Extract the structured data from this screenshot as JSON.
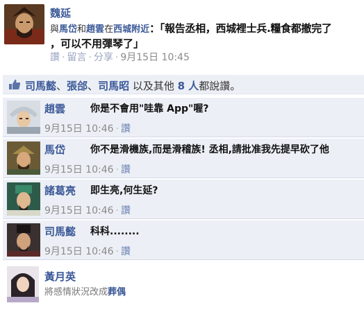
{
  "post": {
    "author": "魏延",
    "with_prefix": "與",
    "tag1": "馬岱",
    "and_word": "和",
    "tag2": "趙雲",
    "at_word": "在",
    "place": "西城附近",
    "message_line1": "：「報告丞相，西城裡士兵.糧食都撤完了",
    "message_line2": "，可以不用彈琴了」",
    "actions": [
      "讚",
      "留言",
      "分享"
    ],
    "timestamp": "9月15日 10:45"
  },
  "likes": {
    "name1": "司馬懿",
    "sep1": "、",
    "name2": "張郃",
    "sep2": "、",
    "name3": "司馬昭",
    "middle": " 以及其他 ",
    "count": "8 人",
    "suffix": "都說讚。"
  },
  "comments": [
    {
      "name": "趙雲",
      "text": "你是不會用\"哇靠 App\"喔?",
      "time": "9月15日 10:46",
      "like": "讚"
    },
    {
      "name": "馬岱",
      "text": "你不是滑機族,而是滑稽族! 丞相,請批准我先提早砍了他",
      "time": "9月15日 10:46",
      "like": "讚"
    },
    {
      "name": "諸葛亮",
      "text": "即生亮,何生延?",
      "time": "9月15日 10:46",
      "like": "讚"
    },
    {
      "name": "司馬懿",
      "text": "科科........",
      "time": "9月15日 10:46",
      "like": "讚"
    }
  ],
  "status_update": {
    "name": "黃月英",
    "text_prefix": "將感情狀況改成",
    "status": "葬偶"
  },
  "colors": {
    "link": "#3b5998",
    "comment_bg": "#eceff5",
    "meta": "#8a8a8a"
  },
  "icons": {
    "like": "thumbs-up-icon"
  }
}
